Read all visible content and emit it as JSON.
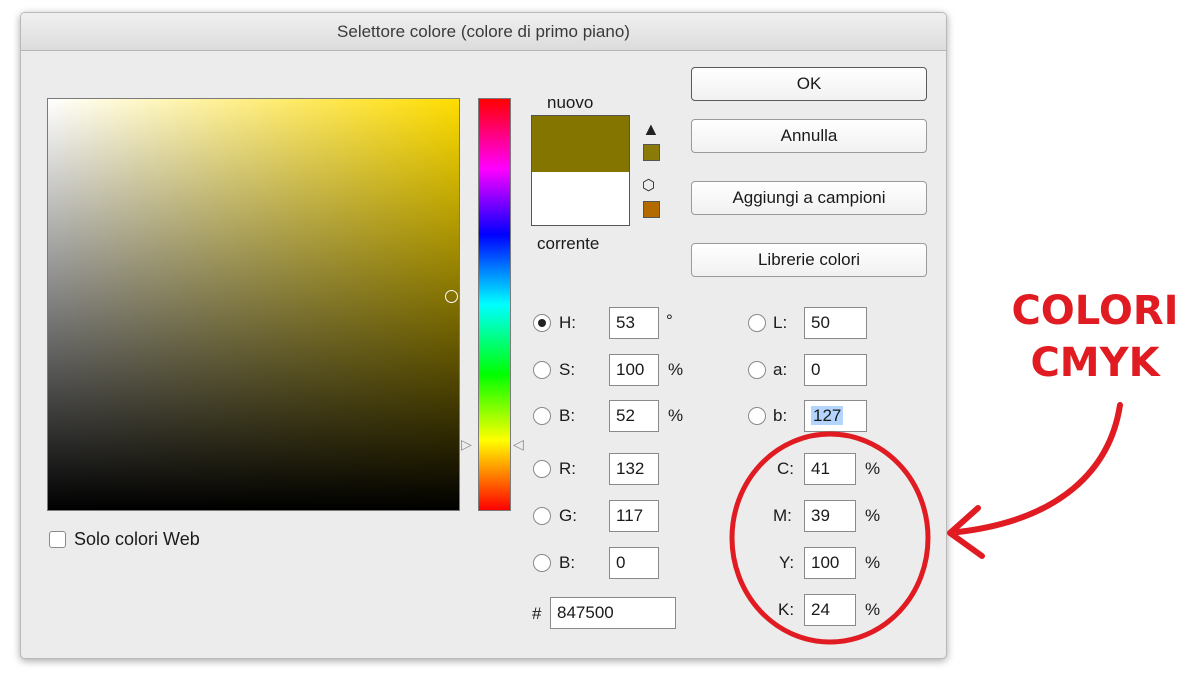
{
  "dialog": {
    "title": "Selettore colore (colore di primo piano)",
    "new_color_hex": "#847500",
    "current_color_hex": "#ffffff"
  },
  "swatch": {
    "new_label": "nuovo",
    "current_label": "corrente",
    "gamut_warning_icon": "warning-triangle-icon",
    "gamut_swatch_color": "#8a7a08",
    "web_warning_icon": "cube-icon",
    "web_swatch_color": "#b36b00"
  },
  "buttons": {
    "ok": "OK",
    "cancel": "Annulla",
    "add_swatch": "Aggiungi a campioni",
    "libraries": "Librerie colori"
  },
  "web_only": {
    "label": "Solo colori Web",
    "checked": false
  },
  "hsb": {
    "h": {
      "label": "H:",
      "value": "53",
      "unit": "°",
      "selected": true
    },
    "s": {
      "label": "S:",
      "value": "100",
      "unit": "%"
    },
    "b": {
      "label": "B:",
      "value": "52",
      "unit": "%"
    }
  },
  "rgb": {
    "r": {
      "label": "R:",
      "value": "132"
    },
    "g": {
      "label": "G:",
      "value": "117"
    },
    "b": {
      "label": "B:",
      "value": "0"
    }
  },
  "lab": {
    "l": {
      "label": "L:",
      "value": "50"
    },
    "a": {
      "label": "a:",
      "value": "0"
    },
    "b": {
      "label": "b:",
      "value": "127"
    }
  },
  "cmyk": {
    "c": {
      "label": "C:",
      "value": "41",
      "unit": "%"
    },
    "m": {
      "label": "M:",
      "value": "39",
      "unit": "%"
    },
    "y": {
      "label": "Y:",
      "value": "100",
      "unit": "%"
    },
    "k": {
      "label": "K:",
      "value": "24",
      "unit": "%"
    }
  },
  "hex": {
    "label": "#",
    "value": "847500"
  },
  "annotation": {
    "line1": "COLORI",
    "line2": "CMYK",
    "color": "#e11b22"
  }
}
